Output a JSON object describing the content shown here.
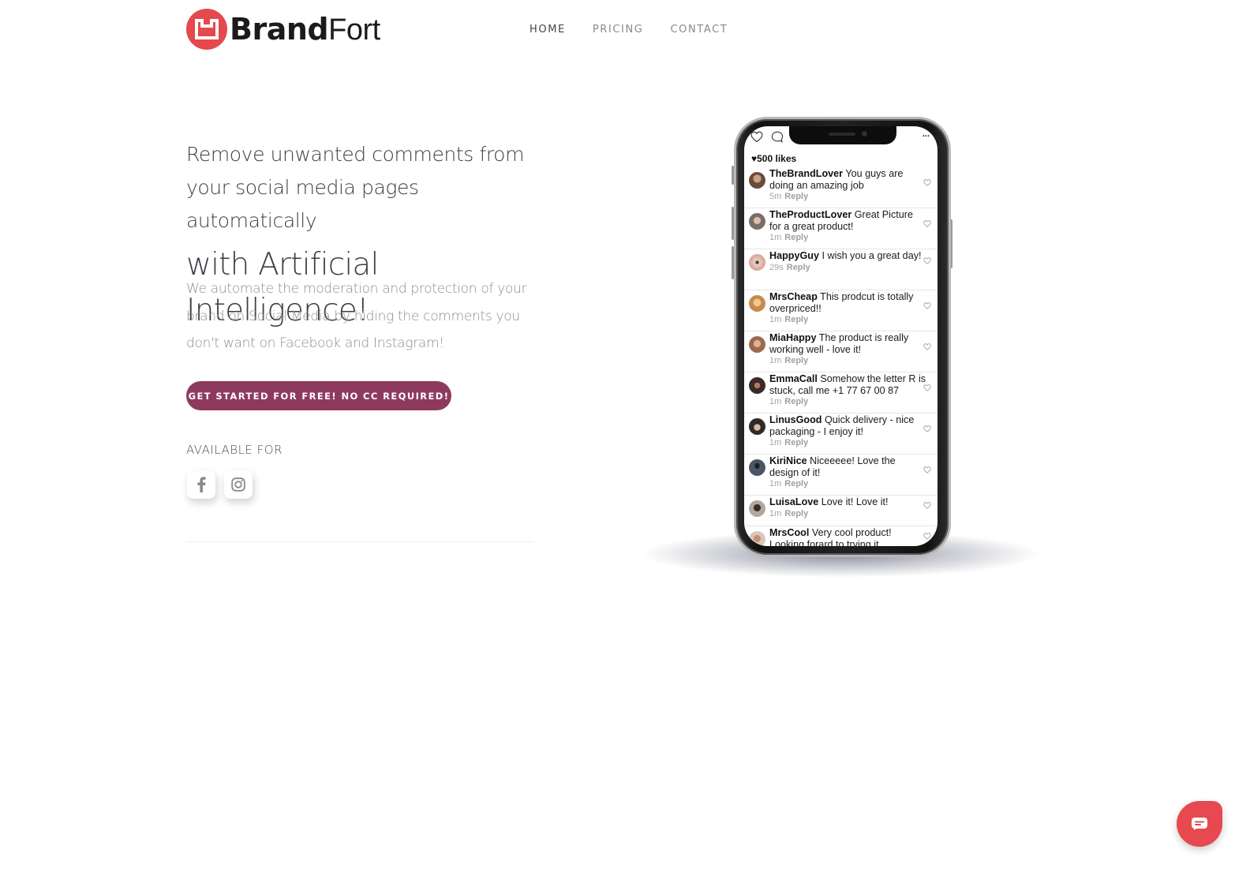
{
  "brand": {
    "name_bold": "Brand",
    "name_light": "Fort",
    "logo_color": "#e5484d"
  },
  "nav": {
    "items": [
      {
        "label": "HOME",
        "active": true
      },
      {
        "label": "PRICING",
        "active": false
      },
      {
        "label": "CONTACT",
        "active": false
      }
    ]
  },
  "hero": {
    "headline_line1": "Remove unwanted comments from",
    "headline_line2": "your social media pages automatically",
    "headline_line3": "with Artificial Intelligence!",
    "description": "We automate the moderation and protection of your brand on Social Media by hiding the comments you don't want on Facebook and Instagram!",
    "cta_label": "GET STARTED FOR FREE! NO CC REQUIRED!",
    "cta_color": "#8e3a5e",
    "available_label": "AVAILABLE FOR",
    "platforms": [
      {
        "name": "Facebook",
        "icon": "facebook-icon"
      },
      {
        "name": "Instagram",
        "icon": "instagram-icon"
      }
    ]
  },
  "phone": {
    "likes": "500 likes",
    "more": "...",
    "comments": [
      {
        "user": "TheBrandLover",
        "text": "You guys are doing an amazing job",
        "time": "5m",
        "reply": "Reply",
        "avatar_color": "#6b4a3a"
      },
      {
        "user": "TheProductLover",
        "text": "Great Picture for a great product!",
        "time": "1m",
        "reply": "Reply",
        "avatar_color": "#7a6d65"
      },
      {
        "user": "HappyGuy",
        "text": "I wish you a great day!",
        "time": "29s",
        "reply": "Reply",
        "avatar_color": "#d9a89a"
      },
      {
        "user": "MrsCheap",
        "text": "This prodcut is totally overpriced!!",
        "time": "1m",
        "reply": "Reply",
        "avatar_color": "#c88a4a"
      },
      {
        "user": "MiaHappy",
        "text": "The product is really working well - love it!",
        "time": "1m",
        "reply": "Reply",
        "avatar_color": "#9a6a4e"
      },
      {
        "user": "EmmaCall",
        "text": "Somehow the letter R is stuck, call me +1 77 67 00 87",
        "time": "1m",
        "reply": "Reply",
        "avatar_color": "#3a2a28"
      },
      {
        "user": "LinusGood",
        "text": "Quick delivery - nice packaging - I enjoy it!",
        "time": "1m",
        "reply": "Reply",
        "avatar_color": "#2e2a26"
      },
      {
        "user": "KiriNice",
        "text": "Niceeeee! Love the design of it!",
        "time": "1m",
        "reply": "Reply",
        "avatar_color": "#4a5565"
      },
      {
        "user": "LuisaLove",
        "text": "Love it! Love it!",
        "time": "1m",
        "reply": "Reply",
        "avatar_color": "#6d6258"
      },
      {
        "user": "MrsCool",
        "text": "Very cool product! Looking forard to trying it",
        "time": "",
        "reply": "",
        "avatar_color": "#a88a78"
      }
    ]
  },
  "chat": {
    "icon": "chat-icon",
    "color": "#e8484f"
  }
}
